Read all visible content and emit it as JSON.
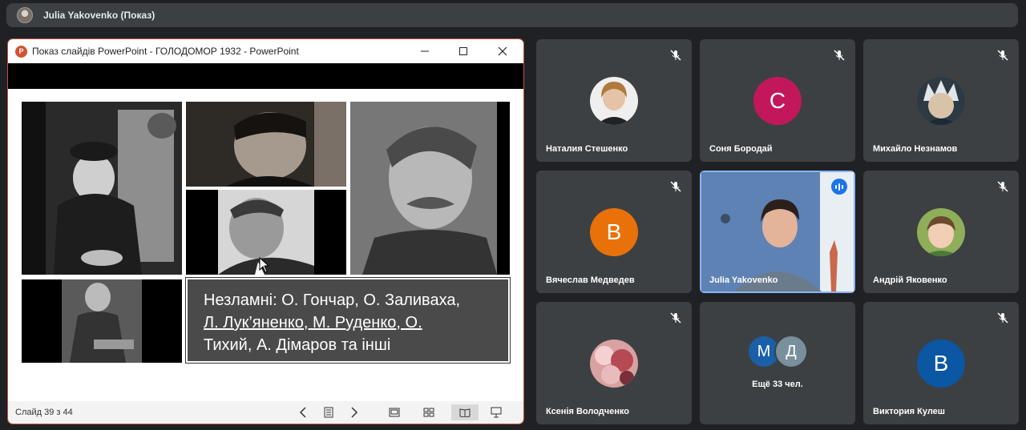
{
  "top_bar": {
    "presenter_label": "Julia Yakovenko (Показ)"
  },
  "ppt": {
    "window_title": "Показ слайдів PowerPoint  -  ГОЛОДОМОР 1932  -  PowerPoint",
    "app_icon_letter": "P",
    "slide_caption": {
      "line1": "Незламні: О. Гончар, О. Заливаха,",
      "line2": "Л. Лук’яненко, М. Руденко, О.",
      "line3": "Тихий, А. Дімаров та інші"
    },
    "status": {
      "slide_counter": "Слайд 39 з 44"
    }
  },
  "participants": [
    {
      "name": "Наталия Стешенко",
      "avatar_type": "photo",
      "muted": true
    },
    {
      "name": "Соня Бородай",
      "avatar_letter": "С",
      "avatar_color": "#c2185b",
      "muted": true
    },
    {
      "name": "Михайло Незнамов",
      "avatar_type": "photo",
      "muted": true
    },
    {
      "name": "Вячеслав Медведев",
      "avatar_letter": "В",
      "avatar_color": "#e8710a",
      "muted": true
    },
    {
      "name": "Julia Yakovenko",
      "avatar_type": "video",
      "speaking": true
    },
    {
      "name": "Андрій Яковенко",
      "avatar_type": "photo",
      "muted": true
    },
    {
      "name": "Ксенія Володченко",
      "avatar_type": "photo",
      "muted": true
    },
    {
      "more_label": "Ещё 33 чел.",
      "more_avatars": [
        {
          "letter": "М",
          "color": "#1a5fa8"
        },
        {
          "letter": "Д",
          "color": "#78909c"
        }
      ]
    },
    {
      "name": "Виктория Кулеш",
      "avatar_letter": "В",
      "avatar_color": "#0b57a4",
      "muted": true
    }
  ]
}
